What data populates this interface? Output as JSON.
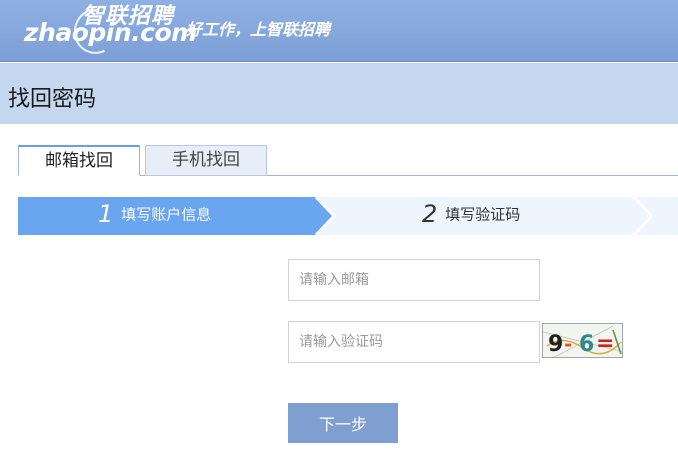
{
  "header": {
    "logo_cn": "智联招聘",
    "logo_en": "zhaopin.com",
    "slogan": "好工作，上智联招聘"
  },
  "page": {
    "title": "找回密码"
  },
  "tabs": [
    {
      "label": "邮箱找回",
      "active": true
    },
    {
      "label": "手机找回",
      "active": false
    }
  ],
  "steps": [
    {
      "number": "1",
      "label": "填写账户信息",
      "active": true
    },
    {
      "number": "2",
      "label": "填写验证码",
      "active": false
    }
  ],
  "form": {
    "email_placeholder": "请输入邮箱",
    "captcha_placeholder": "请输入验证码",
    "captcha_text": "9-6=",
    "next_label": "下一步"
  },
  "colors": {
    "header_bg": "#8fb0e2",
    "titlebar_bg": "#c5d6ef",
    "step_active": "#6aa5f0",
    "step_inactive": "#eef5fc",
    "button_bg": "#7f9fd0"
  }
}
